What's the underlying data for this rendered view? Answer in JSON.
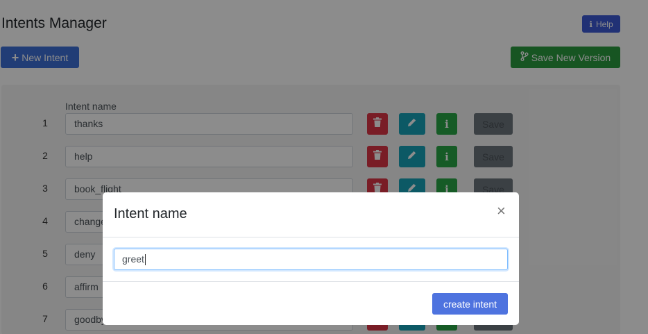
{
  "header": {
    "title": "Intents Manager",
    "help_label": "Help",
    "help_icon": "info-icon",
    "new_intent_label": "New Intent",
    "new_intent_icon": "plus-icon",
    "save_version_label": "Save New Version",
    "save_version_icon": "branch-icon"
  },
  "table": {
    "column_label": "Intent name",
    "save_label": "Save",
    "rows": [
      {
        "num": "1",
        "name": "thanks"
      },
      {
        "num": "2",
        "name": "help"
      },
      {
        "num": "3",
        "name": "book_flight"
      },
      {
        "num": "4",
        "name": "change"
      },
      {
        "num": "5",
        "name": "deny"
      },
      {
        "num": "6",
        "name": "affirm"
      },
      {
        "num": "7",
        "name": "goodbye"
      }
    ]
  },
  "modal": {
    "title": "Intent name",
    "close_glyph": "×",
    "input_value": "greet",
    "create_label": "create intent"
  },
  "colors": {
    "primary": "#3d6fd8",
    "success": "#2a9b3f",
    "danger": "#dc3545",
    "info": "#17a2b8"
  }
}
